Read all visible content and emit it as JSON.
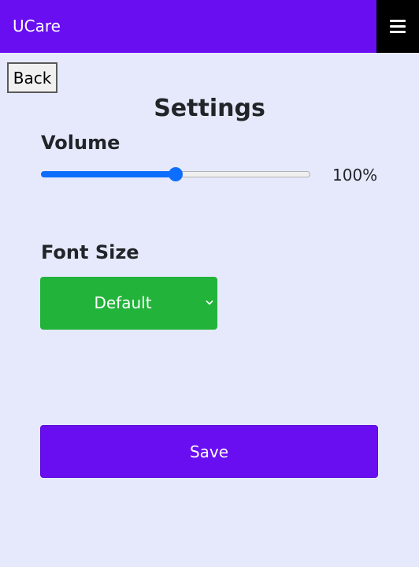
{
  "header": {
    "brand": "UCare",
    "menu_icon": "hamburger-menu-icon"
  },
  "nav": {
    "back_label": "Back"
  },
  "page": {
    "title": "Settings"
  },
  "volume": {
    "label": "Volume",
    "value_text": "100%",
    "slider_fraction": 0.5
  },
  "font_size": {
    "label": "Font Size",
    "selected": "Default",
    "chevron_icon": "chevron-down-icon"
  },
  "actions": {
    "save_label": "Save"
  },
  "colors": {
    "header_bg": "#6a0ef2",
    "menu_bg": "#000000",
    "page_bg": "#e6e9fb",
    "slider_accent": "#0d6efd",
    "select_bg": "#22b33a",
    "save_bg": "#6a0ef2"
  }
}
